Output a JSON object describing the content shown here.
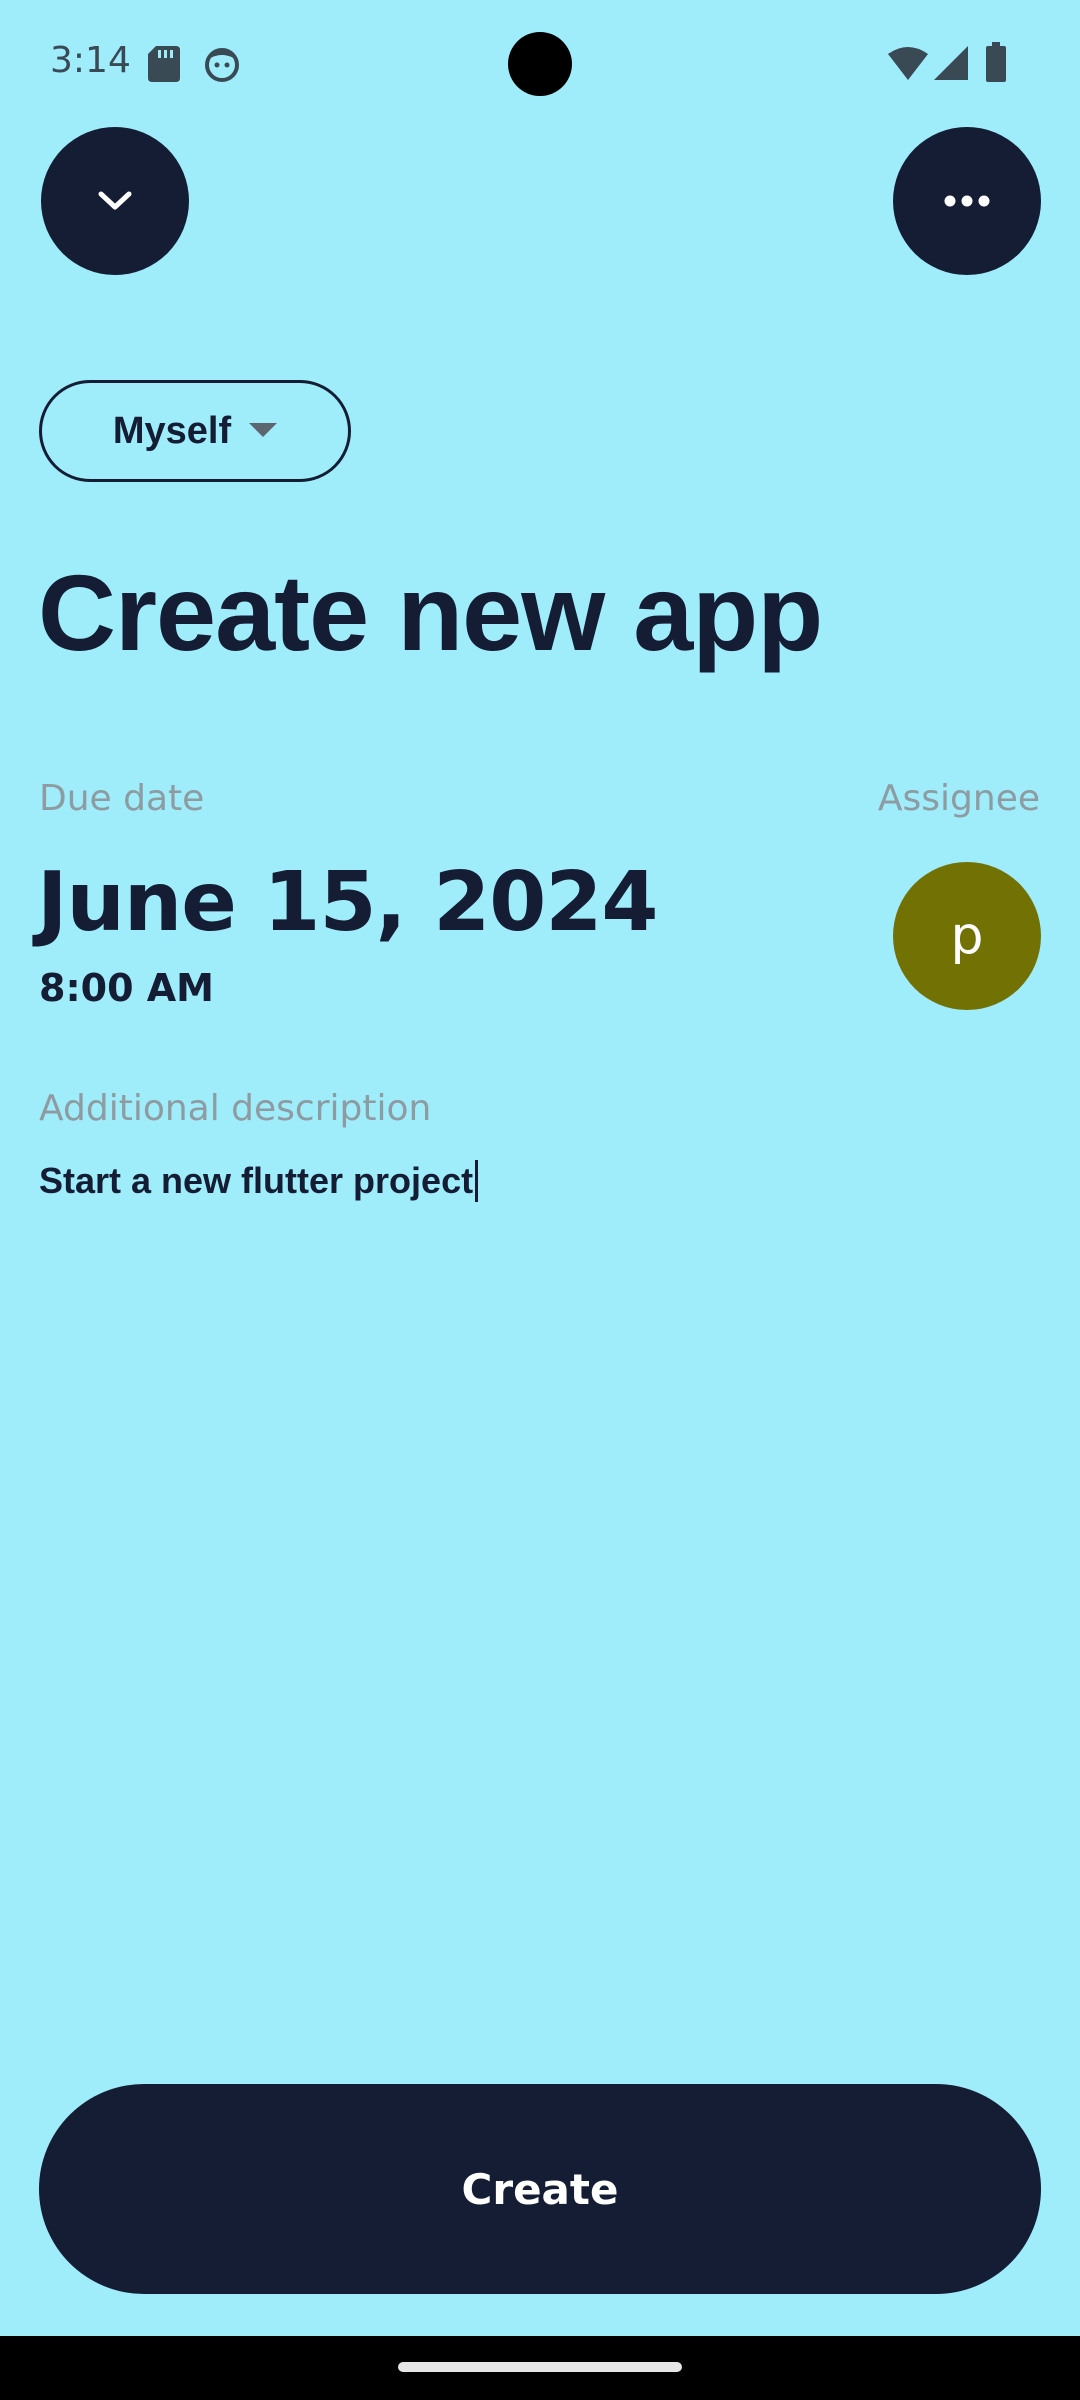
{
  "status_bar": {
    "time": "3:14",
    "icons": [
      "sd-card-icon",
      "face-icon",
      "wifi-icon",
      "signal-icon",
      "battery-icon"
    ]
  },
  "toolbar": {
    "collapse_icon": "chevron-down-icon",
    "more_icon": "more-horizontal-icon"
  },
  "owner_selector": {
    "value": "Myself",
    "icon": "caret-down-icon"
  },
  "title": "Create new app",
  "due_date": {
    "label": "Due date",
    "date": "June 15, 2024",
    "time": "8:00 AM"
  },
  "assignee": {
    "label": "Assignee",
    "initial": "p",
    "color": "#727104"
  },
  "description": {
    "label": "Additional description",
    "value": "Start a new flutter project"
  },
  "actions": {
    "create_label": "Create"
  },
  "colors": {
    "background": "#9fecfb",
    "primary": "#141d33",
    "muted_label": "#8e9ba1"
  }
}
